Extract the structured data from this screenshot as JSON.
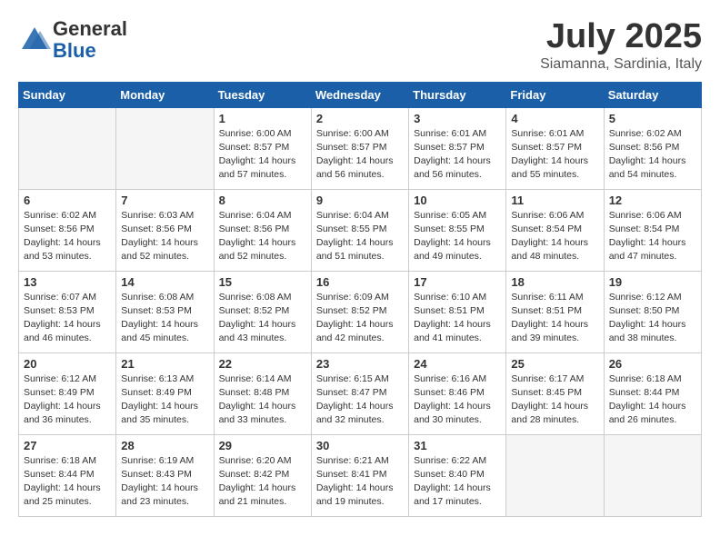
{
  "header": {
    "logo_line1": "General",
    "logo_line2": "Blue",
    "month": "July 2025",
    "location": "Siamanna, Sardinia, Italy"
  },
  "days_of_week": [
    "Sunday",
    "Monday",
    "Tuesday",
    "Wednesday",
    "Thursday",
    "Friday",
    "Saturday"
  ],
  "weeks": [
    [
      {
        "num": "",
        "info": ""
      },
      {
        "num": "",
        "info": ""
      },
      {
        "num": "1",
        "info": "Sunrise: 6:00 AM\nSunset: 8:57 PM\nDaylight: 14 hours and 57 minutes."
      },
      {
        "num": "2",
        "info": "Sunrise: 6:00 AM\nSunset: 8:57 PM\nDaylight: 14 hours and 56 minutes."
      },
      {
        "num": "3",
        "info": "Sunrise: 6:01 AM\nSunset: 8:57 PM\nDaylight: 14 hours and 56 minutes."
      },
      {
        "num": "4",
        "info": "Sunrise: 6:01 AM\nSunset: 8:57 PM\nDaylight: 14 hours and 55 minutes."
      },
      {
        "num": "5",
        "info": "Sunrise: 6:02 AM\nSunset: 8:56 PM\nDaylight: 14 hours and 54 minutes."
      }
    ],
    [
      {
        "num": "6",
        "info": "Sunrise: 6:02 AM\nSunset: 8:56 PM\nDaylight: 14 hours and 53 minutes."
      },
      {
        "num": "7",
        "info": "Sunrise: 6:03 AM\nSunset: 8:56 PM\nDaylight: 14 hours and 52 minutes."
      },
      {
        "num": "8",
        "info": "Sunrise: 6:04 AM\nSunset: 8:56 PM\nDaylight: 14 hours and 52 minutes."
      },
      {
        "num": "9",
        "info": "Sunrise: 6:04 AM\nSunset: 8:55 PM\nDaylight: 14 hours and 51 minutes."
      },
      {
        "num": "10",
        "info": "Sunrise: 6:05 AM\nSunset: 8:55 PM\nDaylight: 14 hours and 49 minutes."
      },
      {
        "num": "11",
        "info": "Sunrise: 6:06 AM\nSunset: 8:54 PM\nDaylight: 14 hours and 48 minutes."
      },
      {
        "num": "12",
        "info": "Sunrise: 6:06 AM\nSunset: 8:54 PM\nDaylight: 14 hours and 47 minutes."
      }
    ],
    [
      {
        "num": "13",
        "info": "Sunrise: 6:07 AM\nSunset: 8:53 PM\nDaylight: 14 hours and 46 minutes."
      },
      {
        "num": "14",
        "info": "Sunrise: 6:08 AM\nSunset: 8:53 PM\nDaylight: 14 hours and 45 minutes."
      },
      {
        "num": "15",
        "info": "Sunrise: 6:08 AM\nSunset: 8:52 PM\nDaylight: 14 hours and 43 minutes."
      },
      {
        "num": "16",
        "info": "Sunrise: 6:09 AM\nSunset: 8:52 PM\nDaylight: 14 hours and 42 minutes."
      },
      {
        "num": "17",
        "info": "Sunrise: 6:10 AM\nSunset: 8:51 PM\nDaylight: 14 hours and 41 minutes."
      },
      {
        "num": "18",
        "info": "Sunrise: 6:11 AM\nSunset: 8:51 PM\nDaylight: 14 hours and 39 minutes."
      },
      {
        "num": "19",
        "info": "Sunrise: 6:12 AM\nSunset: 8:50 PM\nDaylight: 14 hours and 38 minutes."
      }
    ],
    [
      {
        "num": "20",
        "info": "Sunrise: 6:12 AM\nSunset: 8:49 PM\nDaylight: 14 hours and 36 minutes."
      },
      {
        "num": "21",
        "info": "Sunrise: 6:13 AM\nSunset: 8:49 PM\nDaylight: 14 hours and 35 minutes."
      },
      {
        "num": "22",
        "info": "Sunrise: 6:14 AM\nSunset: 8:48 PM\nDaylight: 14 hours and 33 minutes."
      },
      {
        "num": "23",
        "info": "Sunrise: 6:15 AM\nSunset: 8:47 PM\nDaylight: 14 hours and 32 minutes."
      },
      {
        "num": "24",
        "info": "Sunrise: 6:16 AM\nSunset: 8:46 PM\nDaylight: 14 hours and 30 minutes."
      },
      {
        "num": "25",
        "info": "Sunrise: 6:17 AM\nSunset: 8:45 PM\nDaylight: 14 hours and 28 minutes."
      },
      {
        "num": "26",
        "info": "Sunrise: 6:18 AM\nSunset: 8:44 PM\nDaylight: 14 hours and 26 minutes."
      }
    ],
    [
      {
        "num": "27",
        "info": "Sunrise: 6:18 AM\nSunset: 8:44 PM\nDaylight: 14 hours and 25 minutes."
      },
      {
        "num": "28",
        "info": "Sunrise: 6:19 AM\nSunset: 8:43 PM\nDaylight: 14 hours and 23 minutes."
      },
      {
        "num": "29",
        "info": "Sunrise: 6:20 AM\nSunset: 8:42 PM\nDaylight: 14 hours and 21 minutes."
      },
      {
        "num": "30",
        "info": "Sunrise: 6:21 AM\nSunset: 8:41 PM\nDaylight: 14 hours and 19 minutes."
      },
      {
        "num": "31",
        "info": "Sunrise: 6:22 AM\nSunset: 8:40 PM\nDaylight: 14 hours and 17 minutes."
      },
      {
        "num": "",
        "info": ""
      },
      {
        "num": "",
        "info": ""
      }
    ]
  ]
}
